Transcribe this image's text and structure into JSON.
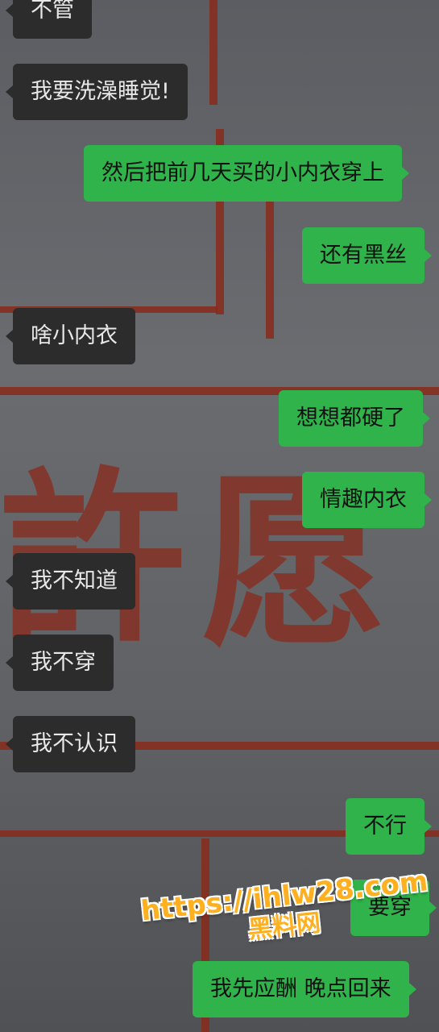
{
  "colors": {
    "outgoing_bubble": "#2fb34a",
    "incoming_bubble": "#2c2c2c",
    "incoming_text": "#e8e8e8",
    "outgoing_text": "#111111",
    "watermark": "#ffb020"
  },
  "messages": [
    {
      "side": "incoming",
      "text": "不管"
    },
    {
      "side": "incoming",
      "text": "我要洗澡睡觉!"
    },
    {
      "side": "outgoing",
      "text": "然后把前几天买的小内衣穿上"
    },
    {
      "side": "outgoing",
      "text": "还有黑丝"
    },
    {
      "side": "incoming",
      "text": "啥小内衣"
    },
    {
      "side": "outgoing",
      "text": "想想都硬了"
    },
    {
      "side": "outgoing",
      "text": "情趣内衣"
    },
    {
      "side": "incoming",
      "text": "我不知道"
    },
    {
      "side": "incoming",
      "text": "我不穿"
    },
    {
      "side": "incoming",
      "text": "我不认识"
    },
    {
      "side": "outgoing",
      "text": "不行"
    },
    {
      "side": "outgoing",
      "text": "要穿"
    },
    {
      "side": "outgoing",
      "text": "我先应酬  晚点回来"
    }
  ],
  "watermark": {
    "url": "https://ihlw28.com",
    "name": "黑料网"
  }
}
